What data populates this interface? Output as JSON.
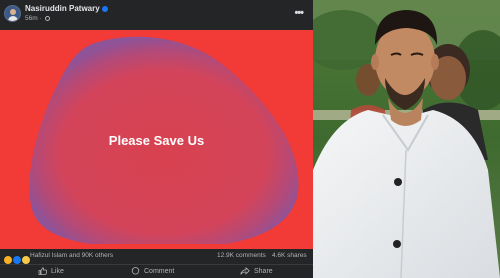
{
  "post": {
    "author": "Nasiruddin Patwary",
    "time": "56m",
    "image_text": "Please Save Us",
    "reactions_summary": "Hafizul Islam and 90K others",
    "comments": "12.9K comments",
    "shares": "4.6K shares",
    "actions": {
      "like": "Like",
      "comment": "Comment",
      "share": "Share"
    },
    "reaction_icons": [
      "sad-reaction-icon",
      "like-reaction-icon",
      "haha-reaction-icon"
    ]
  },
  "colors": {
    "background": "#242526",
    "image_red": "#f23a36",
    "blob_pink": "#d8424f",
    "blob_edge": "#9b4f8c",
    "verified_blue": "#1877f2"
  }
}
